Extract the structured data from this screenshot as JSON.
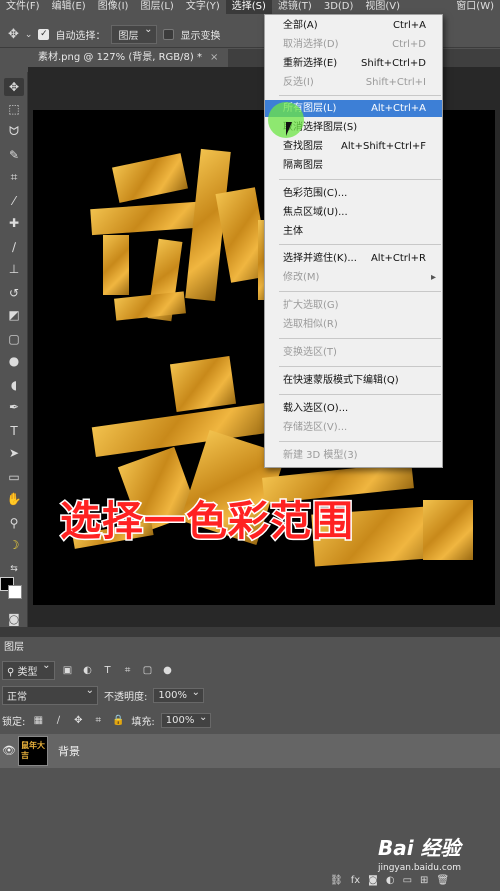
{
  "menubar": {
    "items": [
      "文件(F)",
      "编辑(E)",
      "图像(I)",
      "图层(L)",
      "文字(Y)",
      "选择(S)",
      "滤镜(T)",
      "3D(D)",
      "视图(V)",
      "窗口(W)"
    ]
  },
  "options": {
    "auto_select_label": "自动选择：",
    "auto_select_value": "图层",
    "show_transform_label": "显示变换"
  },
  "document": {
    "tab_title": "素材.png @ 127% (背景, RGB/8) *",
    "close": "×"
  },
  "overlay": {
    "caption": "选择一色彩范围",
    "caption_color": "#ff2222"
  },
  "select_menu": {
    "items": [
      {
        "label": "全部(A)",
        "shortcut": "Ctrl+A"
      },
      {
        "label": "取消选择(D)",
        "shortcut": "Ctrl+D"
      },
      {
        "label": "重新选择(E)",
        "shortcut": "Shift+Ctrl+D"
      },
      {
        "label": "反选(I)",
        "shortcut": "Shift+Ctrl+I"
      },
      {
        "label": "所有图层(L)",
        "shortcut": "Alt+Ctrl+A"
      },
      {
        "label": "取消选择图层(S)",
        "shortcut": ""
      },
      {
        "label": "查找图层",
        "shortcut": "Alt+Shift+Ctrl+F"
      },
      {
        "label": "隔离图层",
        "shortcut": ""
      },
      {
        "label": "色彩范围(C)...",
        "shortcut": ""
      },
      {
        "label": "焦点区域(U)...",
        "shortcut": ""
      },
      {
        "label": "主体",
        "shortcut": ""
      },
      {
        "label": "选择并遮住(K)...",
        "shortcut": "Alt+Ctrl+R"
      },
      {
        "label": "修改(M)",
        "shortcut": ""
      },
      {
        "label": "扩大选取(G)",
        "shortcut": ""
      },
      {
        "label": "选取相似(R)",
        "shortcut": ""
      },
      {
        "label": "变换选区(T)",
        "shortcut": ""
      },
      {
        "label": "在快速蒙版模式下编辑(Q)",
        "shortcut": ""
      },
      {
        "label": "载入选区(O)...",
        "shortcut": ""
      },
      {
        "label": "存储选区(V)...",
        "shortcut": ""
      },
      {
        "label": "新建 3D 模型(3)",
        "shortcut": ""
      }
    ],
    "highlight_color": "#3d7fd6"
  },
  "layers_panel": {
    "tab_label": "图层",
    "filter_kind": "类型",
    "blend_mode": "正常",
    "opacity_label": "不透明度:",
    "opacity_value": "100%",
    "lock_label": "锁定:",
    "fill_label": "填充:",
    "fill_value": "100%",
    "layer_name": "背景",
    "thumb_text": "鼠年大吉"
  },
  "watermark": {
    "brand": "Bai 经验",
    "url": "jingyan.baidu.com"
  }
}
